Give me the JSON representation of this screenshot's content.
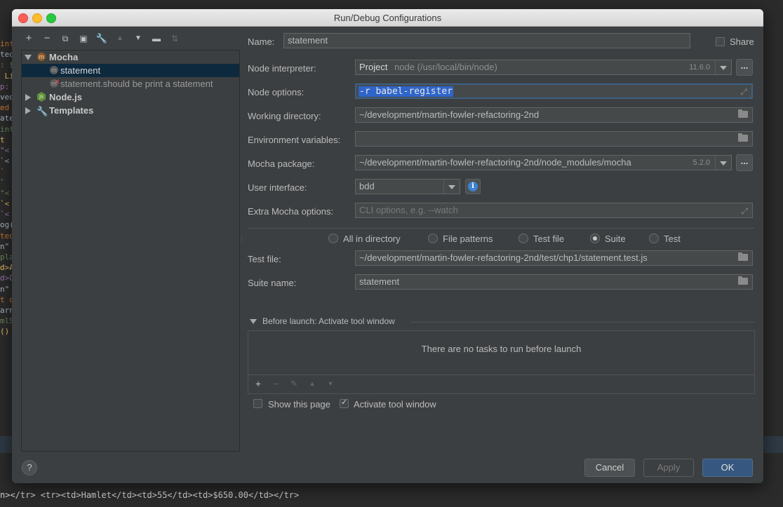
{
  "dialog": {
    "title": "Run/Debug Configurations"
  },
  "tree": {
    "mocha": {
      "label": "Mocha"
    },
    "statement": {
      "label": "statement"
    },
    "statement_test": {
      "label": "statement.should be print a statement"
    },
    "nodejs": {
      "label": "Node.js"
    },
    "templates": {
      "label": "Templates"
    }
  },
  "form": {
    "name": {
      "label": "Name:",
      "value": "statement"
    },
    "share": {
      "label": "Share",
      "checked": false
    },
    "interpreter": {
      "label": "Node interpreter:",
      "prefix": "Project",
      "value": "node (/usr/local/bin/node)",
      "version": "11.6.0"
    },
    "options": {
      "label": "Node options:",
      "value": "-r babel-register"
    },
    "workdir": {
      "label": "Working directory:",
      "value": "~/development/martin-fowler-refactoring-2nd"
    },
    "env": {
      "label": "Environment variables:",
      "value": ""
    },
    "mocha_pkg": {
      "label": "Mocha package:",
      "value": "~/development/martin-fowler-refactoring-2nd/node_modules/mocha",
      "version": "5.2.0"
    },
    "ui": {
      "label": "User interface:",
      "value": "bdd"
    },
    "extra": {
      "label": "Extra Mocha options:",
      "placeholder": "CLI options, e.g. --watch"
    },
    "radios": [
      "All in directory",
      "File patterns",
      "Test file",
      "Suite",
      "Test"
    ],
    "radio_selected": "Suite",
    "test_file": {
      "label": "Test file:",
      "value": "~/development/martin-fowler-refactoring-2nd/test/chp1/statement.test.js"
    },
    "suite": {
      "label": "Suite name:",
      "value": "statement"
    }
  },
  "before_launch": {
    "header": "Before launch: Activate tool window",
    "empty": "There are no tasks to run before launch",
    "show_page": {
      "label": "Show this page",
      "checked": false
    },
    "activate": {
      "label": "Activate tool window",
      "checked": true
    }
  },
  "buttons": {
    "cancel": "Cancel",
    "apply": "Apply",
    "ok": "OK",
    "help": "?"
  },
  "background": {
    "bottom_code": "n></tr>  <tr><td>Hamlet</td><td>55</td><td>$650.00</td></tr>",
    "left_fragments": [
      "int",
      "ted",
      ": $",
      " Li",
      "p:",
      "ved",
      "ed",
      "ate",
      "int",
      "t",
      "\"<",
      "`<",
      "`",
      "`",
      "\"<",
      "`<",
      "`<",
      "og(",
      "ted",
      "n\"",
      "pla",
      "d>A",
      "d>O",
      "n\"",
      "t o",
      "arn",
      "mlS",
      "()"
    ]
  },
  "colors": {
    "accent": "#365880",
    "selection": "#0d293e",
    "text_selection": "#2f65ca"
  }
}
